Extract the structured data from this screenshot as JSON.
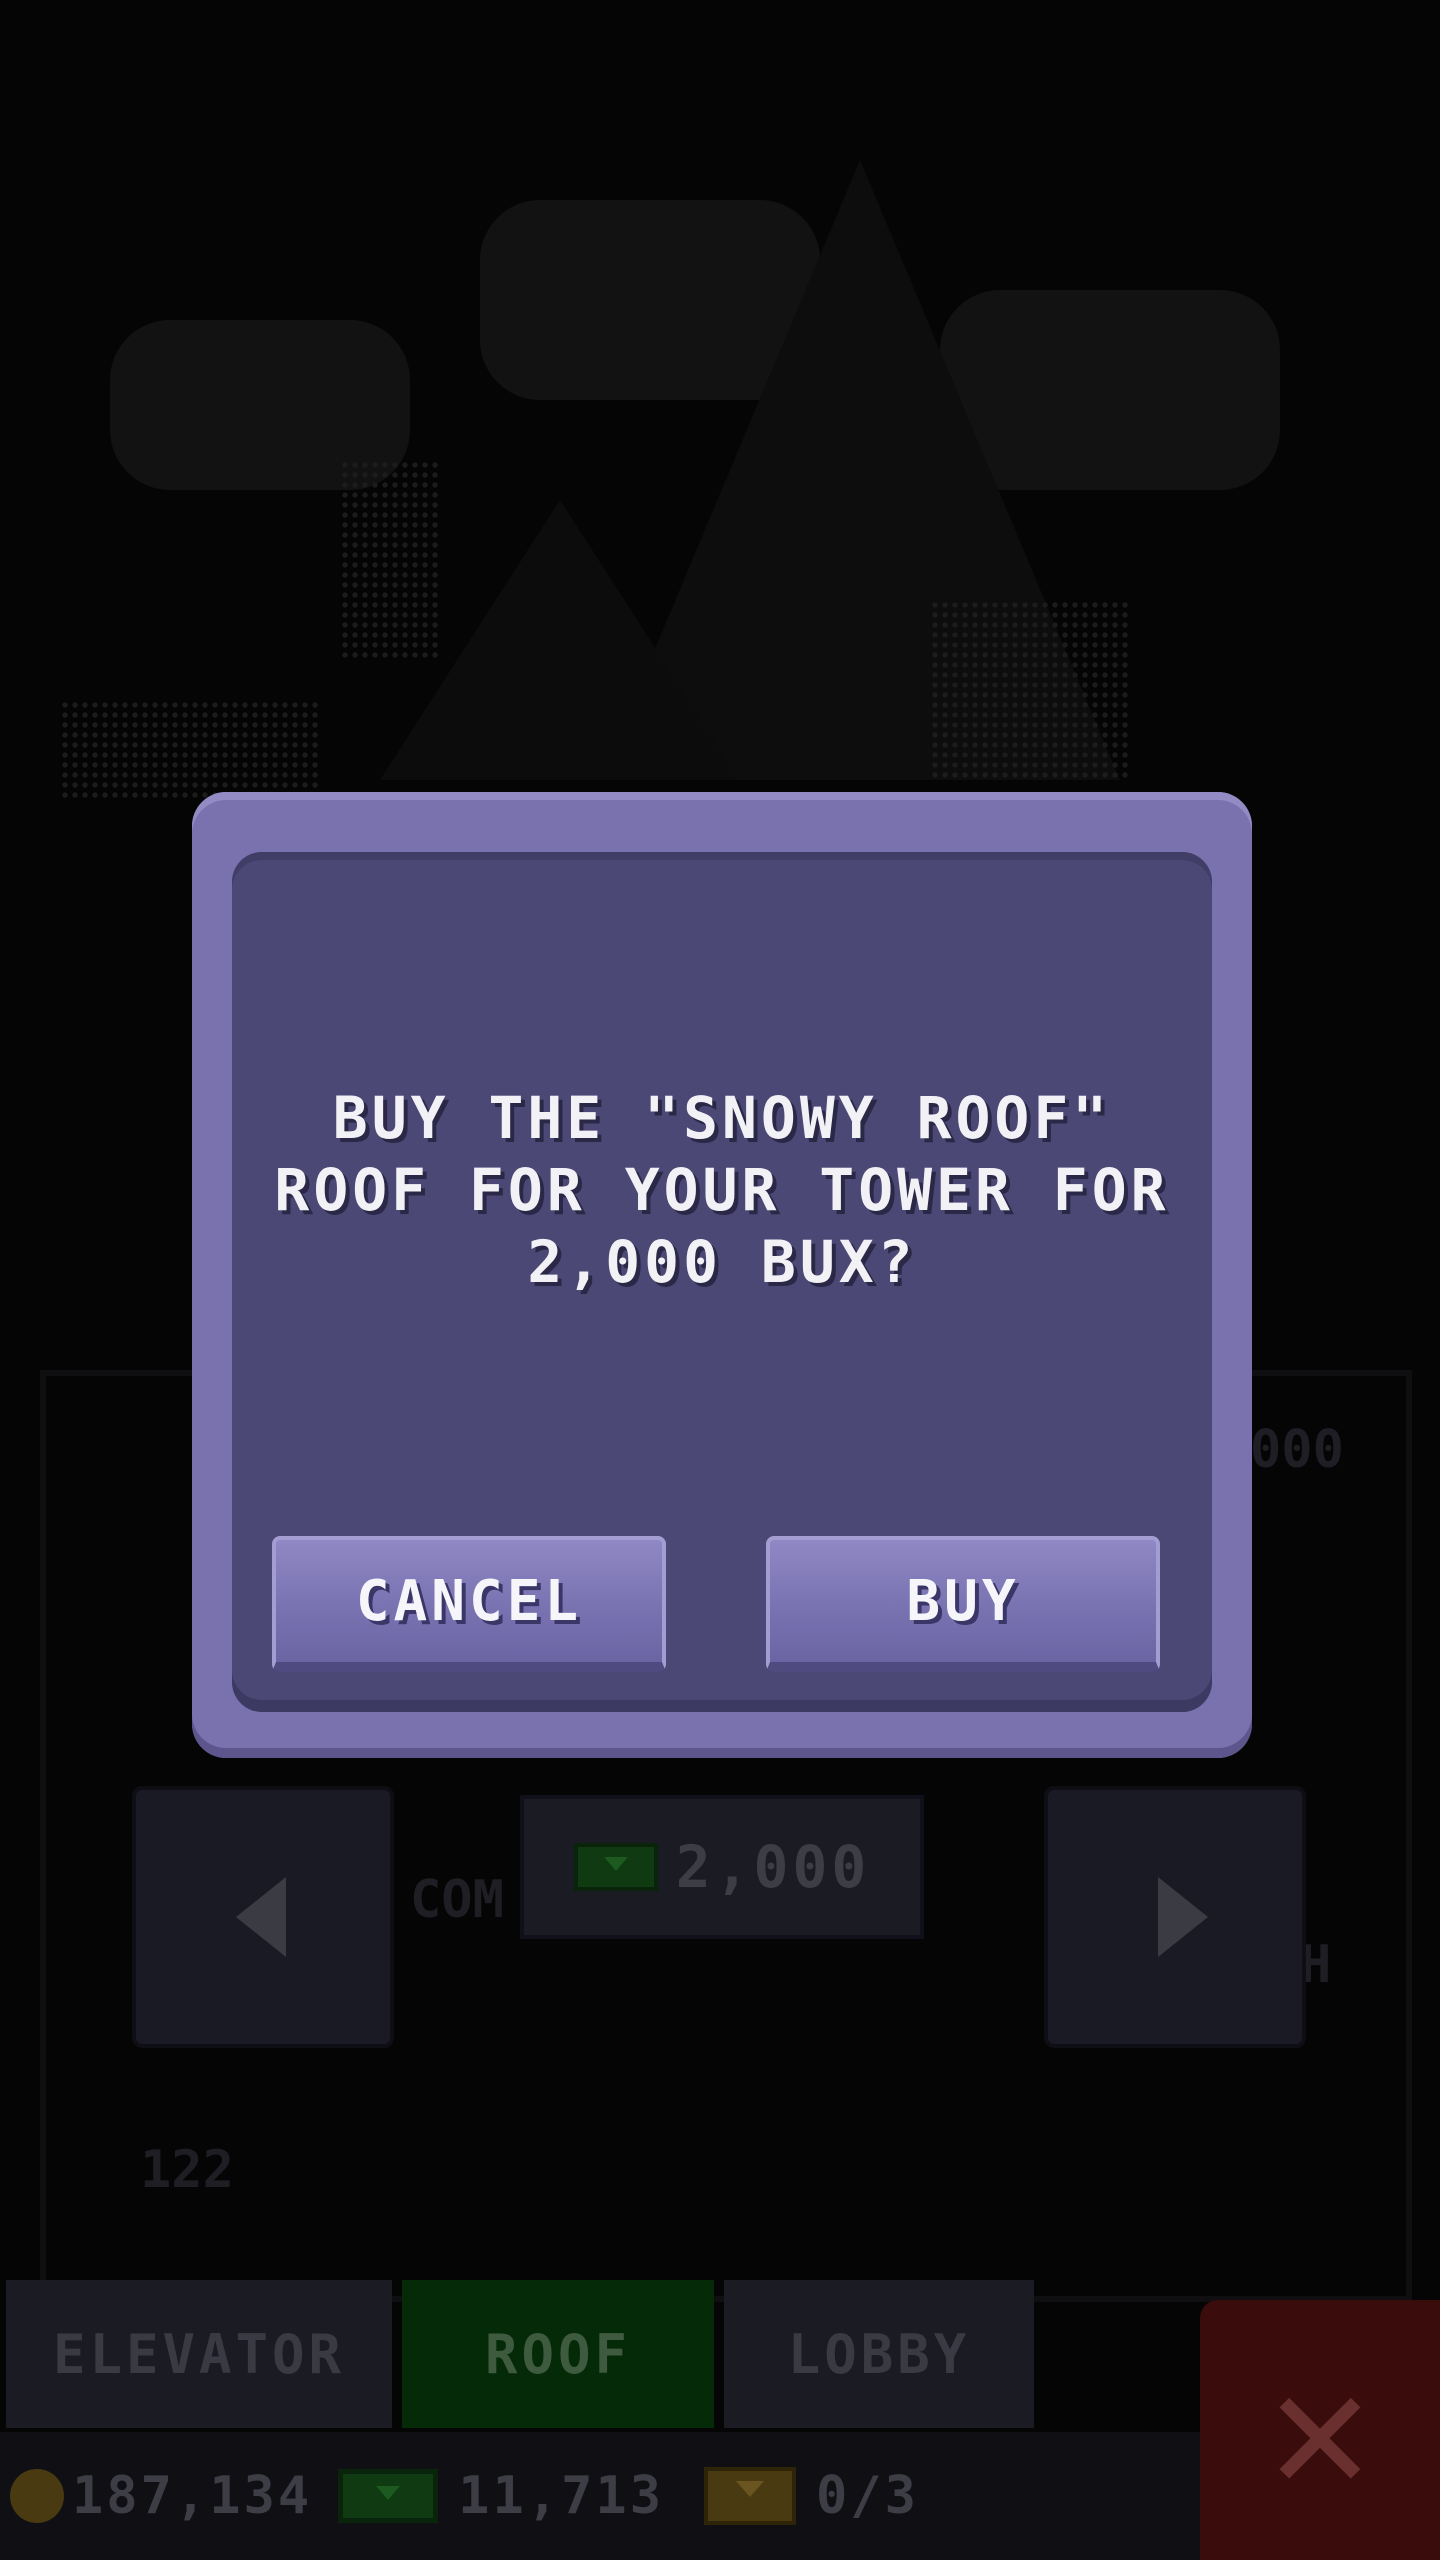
{
  "dialog": {
    "message": "BUY THE \"SNOWY ROOF\"\nROOF FOR YOUR TOWER FOR\n2,000 BUX?",
    "cancel_label": "CANCEL",
    "buy_label": "BUY"
  },
  "background": {
    "price": "2,000",
    "faint_left": "COM",
    "faint_right": "000",
    "faint_right2": "H",
    "faint_bottom": "122"
  },
  "tabs": {
    "elevator": "ELEVATOR",
    "roof": "ROOF",
    "lobby": "LOBBY",
    "active": "ROOF"
  },
  "status_bar": {
    "coins": "187,134",
    "bux": "11,713",
    "tickets": "0/3"
  },
  "icons": {
    "close": "close-icon",
    "left_arrow": "arrow-left-icon",
    "right_arrow": "arrow-right-icon",
    "coin": "coin-icon",
    "bux": "bux-icon",
    "ticket": "ticket-icon"
  },
  "colors": {
    "dialog_frame": "#7a72ae",
    "dialog_inner": "#4b4875",
    "active_tab": "#052a07",
    "close_button": "#3a0c0c"
  }
}
